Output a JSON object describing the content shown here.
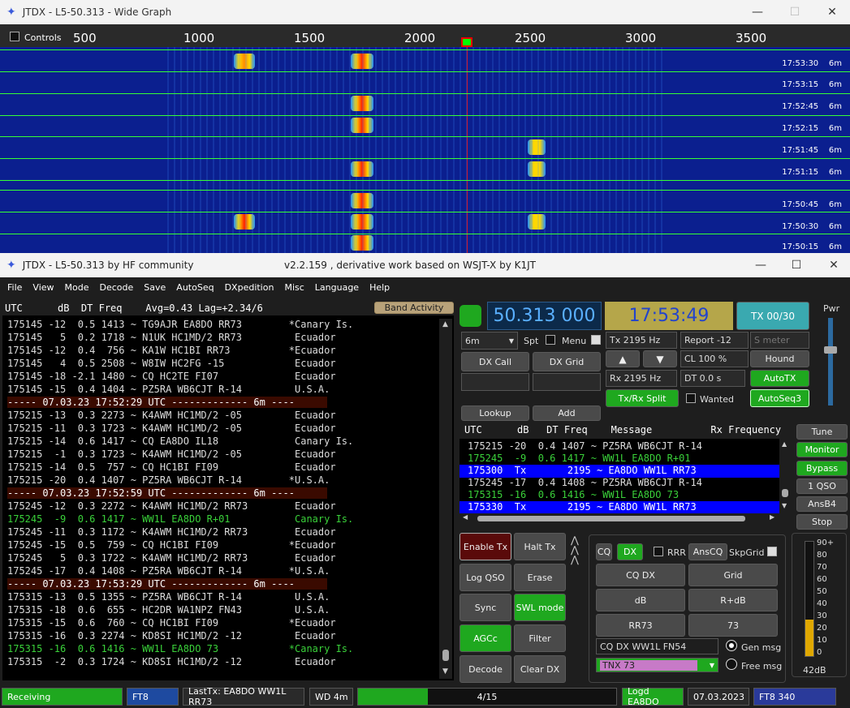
{
  "wide_graph": {
    "title": "JTDX - L5-50.313 - Wide Graph",
    "controls_label": "Controls",
    "scale": [
      "500",
      "1000",
      "1500",
      "2000",
      "2500",
      "3000",
      "3500"
    ],
    "timestamps": [
      "17:53:30",
      "17:53:15",
      "17:52:45",
      "17:52:15",
      "17:51:45",
      "17:51:15",
      "17:50:45",
      "17:50:30",
      "17:50:15"
    ],
    "band_label": "6m"
  },
  "main": {
    "title": "JTDX - L5-50.313  by HF community",
    "subtitle": "v2.2.159 , derivative work based on WSJT-X by K1JT",
    "menu": [
      "File",
      "View",
      "Mode",
      "Decode",
      "Save",
      "AutoSeq",
      "DXpedition",
      "Misc",
      "Language",
      "Help"
    ],
    "band_header": "UTC      dB  DT Freq    Avg=0.43 Lag=+2.34/6",
    "band_activity_label": "Band Activity",
    "band_lines": [
      {
        "t": "175145 -12  0.5 1413 ~ TG9AJR EA8DO RR73        *Canary Is.",
        "c": "n"
      },
      {
        "t": "175145   5  0.2 1718 ~ N1UK HC1MD/2 RR73         Ecuador",
        "c": "n"
      },
      {
        "t": "175145 -12  0.4  756 ~ KA1W HC1BI RR73          *Ecuador",
        "c": "n"
      },
      {
        "t": "175145   4  0.5 2508 ~ W8IW HC2FG -15            Ecuador",
        "c": "n"
      },
      {
        "t": "175145 -18 -2.1 1480 ~ CQ HC2TE FI07             Ecuador",
        "c": "n"
      },
      {
        "t": "175145 -15  0.4 1404 ~ PZ5RA WB6CJT R-14         U.S.A.",
        "c": "n"
      },
      {
        "t": "----- 07.03.23 17:52:29 UTC ------------- 6m ----",
        "c": "s"
      },
      {
        "t": "175215 -13  0.3 2273 ~ K4AWM HC1MD/2 -05         Ecuador",
        "c": "n"
      },
      {
        "t": "175215 -11  0.3 1723 ~ K4AWM HC1MD/2 -05         Ecuador",
        "c": "n"
      },
      {
        "t": "175215 -14  0.6 1417 ~ CQ EA8DO IL18             Canary Is.",
        "c": "n"
      },
      {
        "t": "175215  -1  0.3 1723 ~ K4AWM HC1MD/2 -05         Ecuador",
        "c": "n"
      },
      {
        "t": "175215 -14  0.5  757 ~ CQ HC1BI FI09             Ecuador",
        "c": "n"
      },
      {
        "t": "175215 -20  0.4 1407 ~ PZ5RA WB6CJT R-14        *U.S.A.",
        "c": "n"
      },
      {
        "t": "----- 07.03.23 17:52:59 UTC ------------- 6m ----",
        "c": "s"
      },
      {
        "t": "175245 -12  0.3 2272 ~ K4AWM HC1MD/2 RR73        Ecuador",
        "c": "n"
      },
      {
        "t": "175245  -9  0.6 1417 ~ WW1L EA8DO R+01           Canary Is.",
        "c": "g"
      },
      {
        "t": "175245 -11  0.3 1172 ~ K4AWM HC1MD/2 RR73        Ecuador",
        "c": "n"
      },
      {
        "t": "175245 -15  0.5  759 ~ CQ HC1BI FI09            *Ecuador",
        "c": "n"
      },
      {
        "t": "175245   5  0.3 1722 ~ K4AWM HC1MD/2 RR73        Ecuador",
        "c": "n"
      },
      {
        "t": "175245 -17  0.4 1408 ~ PZ5RA WB6CJT R-14        *U.S.A.",
        "c": "n"
      },
      {
        "t": "----- 07.03.23 17:53:29 UTC ------------- 6m ----",
        "c": "s"
      },
      {
        "t": "175315 -13  0.5 1355 ~ PZ5RA WB6CJT R-14         U.S.A.",
        "c": "n"
      },
      {
        "t": "175315 -18  0.6  655 ~ HC2DR WA1NPZ FN43         U.S.A.",
        "c": "n"
      },
      {
        "t": "175315 -15  0.6  760 ~ CQ HC1BI FI09            *Ecuador",
        "c": "n"
      },
      {
        "t": "175315 -16  0.3 2274 ~ KD8SI HC1MD/2 -12         Ecuador",
        "c": "n"
      },
      {
        "t": "175315 -16  0.6 1416 ~ WW1L EA8DO 73            *Canary Is.",
        "c": "g"
      },
      {
        "t": "175315  -2  0.3 1724 ~ KD8SI HC1MD/2 -12         Ecuador",
        "c": "n"
      }
    ],
    "freq_display": "50.313 000",
    "clock_display": "17:53:49",
    "tx_counter": "TX 00/30",
    "pwr_label": "Pwr",
    "band_select": "6m",
    "spt_label": "Spt",
    "menu_label": "Menu",
    "tx_freq": "Tx  2195  Hz",
    "rx_freq": "Rx  2195  Hz",
    "report": "Report -12",
    "s_meter_placeholder": "S meter",
    "cl_value": "CL  100 %",
    "dt_value": "DT 0.0 s",
    "buttons": {
      "dx_call": "DX Call",
      "dx_grid": "DX Grid",
      "lookup": "Lookup",
      "add": "Add",
      "hound": "Hound",
      "autotx": "AutoTX",
      "txrx_split": "Tx/Rx Split",
      "wanted": "Wanted",
      "autoseq3": "AutoSeq3",
      "tune": "Tune",
      "monitor": "Monitor",
      "bypass": "Bypass",
      "one_qso": "1 QSO",
      "ansb4": "AnsB4",
      "stop": "Stop",
      "enable_tx": "Enable Tx",
      "halt_tx": "Halt Tx",
      "log_qso": "Log QSO",
      "erase": "Erase",
      "sync": "Sync",
      "swl_mode": "SWL mode",
      "agcc": "AGCc",
      "filter": "Filter",
      "decode": "Decode",
      "clear_dx": "Clear DX",
      "cq": "CQ",
      "dx": "DX",
      "rrr": "RRR",
      "anscq": "AnsCQ",
      "skpgrid": "SkpGrid",
      "cq_dx": "CQ DX",
      "grid": "Grid",
      "db": "dB",
      "r_db": "R+dB",
      "rr73": "RR73",
      "m73": "73",
      "gen_msg": "Gen msg",
      "free_msg": "Free msg"
    },
    "rx_header": "UTC      dB   DT Freq    Message          Rx Frequency",
    "rx_lines": [
      {
        "t": "175215 -20  0.4 1407 ~ PZ5RA WB6CJT R-14",
        "c": "n"
      },
      {
        "t": "175245  -9  0.6 1417 ~ WW1L EA8DO R+01",
        "c": "g"
      },
      {
        "t": "175300  Tx       2195 ~ EA8DO WW1L RR73",
        "c": "b"
      },
      {
        "t": "175245 -17  0.4 1408 ~ PZ5RA WB6CJT R-14",
        "c": "n"
      },
      {
        "t": "175315 -16  0.6 1416 ~ WW1L EA8DO 73",
        "c": "g"
      },
      {
        "t": "175330  Tx       2195 ~ EA8DO WW1L RR73",
        "c": "b"
      }
    ],
    "gen_msg_text": "CQ DX WW1L FN54",
    "free_msg_text": "TNX 73",
    "meter_ticks": [
      "90+",
      "80",
      "70",
      "60",
      "50",
      "40",
      "30",
      "20",
      "10",
      "0"
    ],
    "meter_level": 0.32,
    "meter_db": "42dB",
    "status": {
      "receiving": "Receiving",
      "mode": "FT8",
      "last_tx": "LastTx: EA8DO WW1L RR73",
      "wd": "WD 4m",
      "progress": "4/15",
      "progress_value": 0.27,
      "logged": "Logd EA8DO",
      "date": "07.03.2023",
      "mode2": "FT8  340"
    }
  }
}
